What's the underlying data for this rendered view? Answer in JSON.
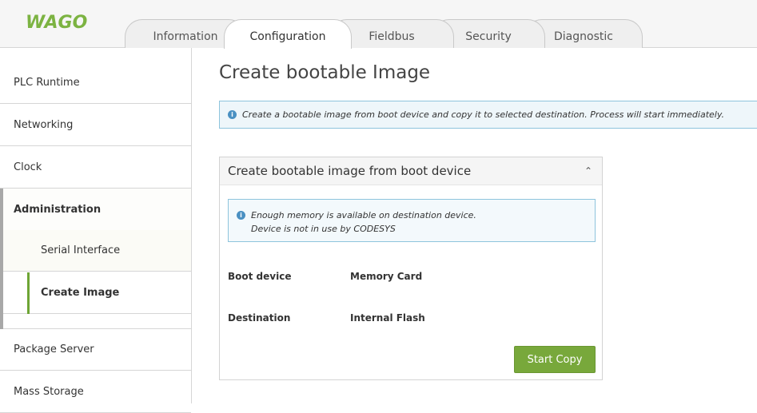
{
  "brand": {
    "logo_text": "WAGO",
    "accent": "#78a83b",
    "logo_color": "#7cb342"
  },
  "tabs": [
    {
      "label": "Information",
      "active": false
    },
    {
      "label": "Configuration",
      "active": true
    },
    {
      "label": "Fieldbus",
      "active": false
    },
    {
      "label": "Security",
      "active": false
    },
    {
      "label": "Diagnostic",
      "active": false
    }
  ],
  "sidebar": {
    "items": [
      {
        "label": "PLC Runtime"
      },
      {
        "label": "Networking"
      },
      {
        "label": "Clock"
      },
      {
        "label": "Administration",
        "expanded": true
      },
      {
        "label": "Serial Interface"
      },
      {
        "label": "Create Image",
        "active": true
      },
      {
        "label": "Package Server"
      },
      {
        "label": "Mass Storage"
      }
    ]
  },
  "main": {
    "title": "Create bootable Image",
    "info_banner": "Create a bootable image from boot device and copy it to selected destination. Process will start immediately.",
    "panel": {
      "title": "Create bootable image from boot device",
      "status_lines": [
        "Enough memory is available on destination device.",
        "Device is not in use by CODESYS"
      ],
      "fields": [
        {
          "label": "Boot device",
          "value": "Memory Card"
        },
        {
          "label": "Destination",
          "value": "Internal Flash"
        }
      ],
      "button_label": "Start Copy"
    }
  }
}
